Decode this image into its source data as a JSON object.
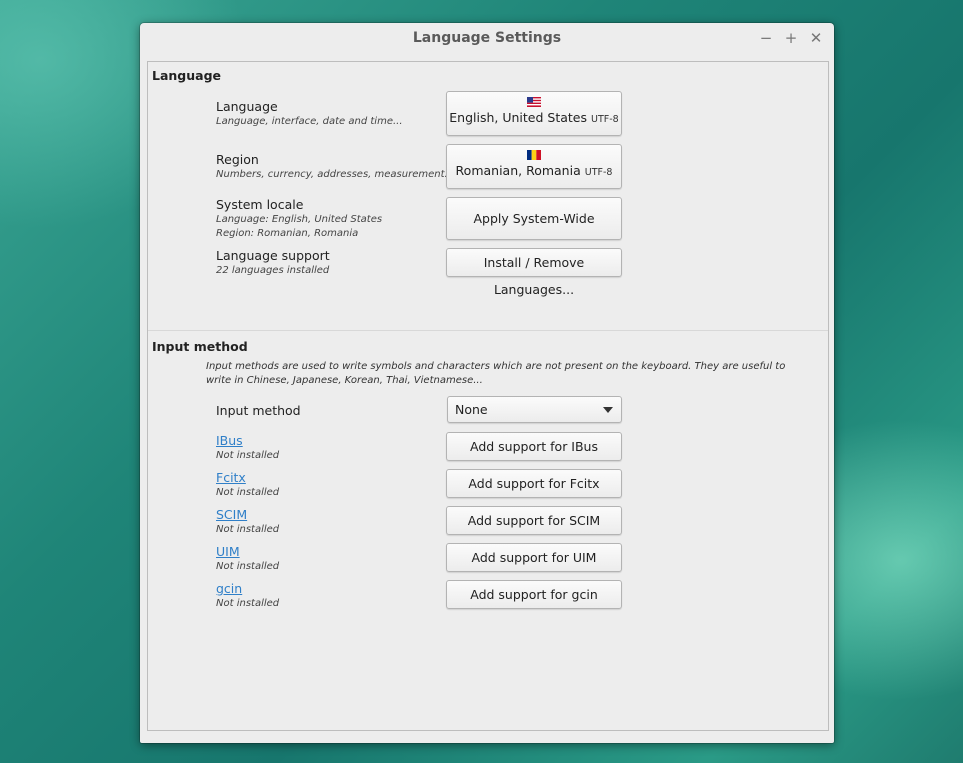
{
  "window": {
    "title": "Language Settings"
  },
  "language_section": {
    "title": "Language",
    "language": {
      "label": "Language",
      "sub": "Language, interface, date and time...",
      "button_value": "English, United States",
      "button_encoding": "UTF-8",
      "flag": "us-flag-icon"
    },
    "region": {
      "label": "Region",
      "sub": "Numbers, currency, addresses, measurement...",
      "button_value": "Romanian, Romania",
      "button_encoding": "UTF-8",
      "flag": "romania-flag-icon"
    },
    "system_locale": {
      "label": "System locale",
      "sub_language": "Language: English, United States",
      "sub_region": "Region: Romanian, Romania",
      "button": "Apply System-Wide"
    },
    "language_support": {
      "label": "Language support",
      "sub": "22 languages installed",
      "button": "Install / Remove Languages..."
    }
  },
  "input_section": {
    "title": "Input method",
    "description": "Input methods are used to write symbols and characters which are not present on the keyboard. They are useful to write in Chinese, Japanese, Korean, Thai, Vietnamese...",
    "input_method_label": "Input method",
    "input_method_value": "None",
    "methods": [
      {
        "name": "IBus",
        "status": "Not installed",
        "button": "Add support for IBus"
      },
      {
        "name": "Fcitx",
        "status": "Not installed",
        "button": "Add support for Fcitx"
      },
      {
        "name": "SCIM",
        "status": "Not installed",
        "button": "Add support for SCIM"
      },
      {
        "name": "UIM",
        "status": "Not installed",
        "button": "Add support for UIM"
      },
      {
        "name": "gcin",
        "status": "Not installed",
        "button": "Add support for gcin"
      }
    ]
  }
}
